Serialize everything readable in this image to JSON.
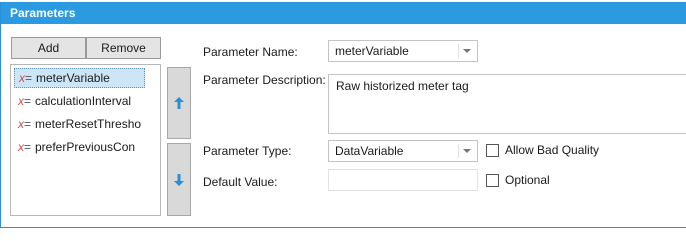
{
  "panel": {
    "title": "Parameters"
  },
  "toolbar": {
    "add_label": "Add",
    "remove_label": "Remove"
  },
  "list": {
    "items": [
      {
        "icon": "variable-icon",
        "label": "meterVariable",
        "selected": true
      },
      {
        "icon": "variable-icon",
        "label": "calculationInterval"
      },
      {
        "icon": "variable-icon",
        "label": "meterResetThresho"
      },
      {
        "icon": "variable-icon",
        "label": "preferPreviousCon"
      }
    ]
  },
  "reorder": {
    "up_icon": "arrow-up-icon",
    "down_icon": "arrow-down-icon",
    "color": "#2b8fd8"
  },
  "form": {
    "name_label": "Parameter Name:",
    "name_value": "meterVariable",
    "description_label": "Parameter Description:",
    "description_value": "Raw historized meter tag",
    "type_label": "Parameter Type:",
    "type_value": "DataVariable",
    "allow_bad_quality_label": "Allow Bad Quality",
    "allow_bad_quality_checked": false,
    "default_label": "Default Value:",
    "default_value": "",
    "optional_label": "Optional",
    "optional_checked": false
  },
  "colors": {
    "header": "#2b9ae0",
    "selection": "#cde6f7",
    "icon_red": "#c8504a"
  }
}
